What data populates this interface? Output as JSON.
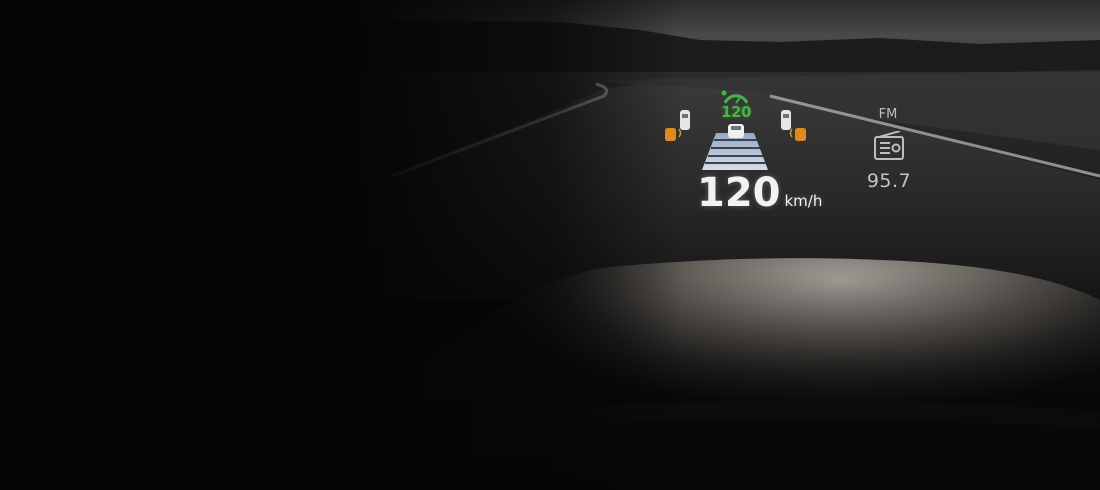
{
  "hud": {
    "speed_limit": "120",
    "speed_value": "120",
    "speed_unit": "km/h",
    "radio_band": "FM",
    "radio_frequency": "95.7",
    "icons": {
      "speed_limit": "speedometer-gauge-icon",
      "lead_vehicle": "car-front-icon",
      "lane_guidance": "lane-ladder-icon",
      "blind_spot": "car-side-warning-icon",
      "radio": "radio-icon"
    }
  },
  "colors": {
    "hud_text": "#f2f2f2",
    "limit_green": "#46b446",
    "warning_orange": "#e08a1e",
    "radio_gray": "#c4c4c4"
  }
}
